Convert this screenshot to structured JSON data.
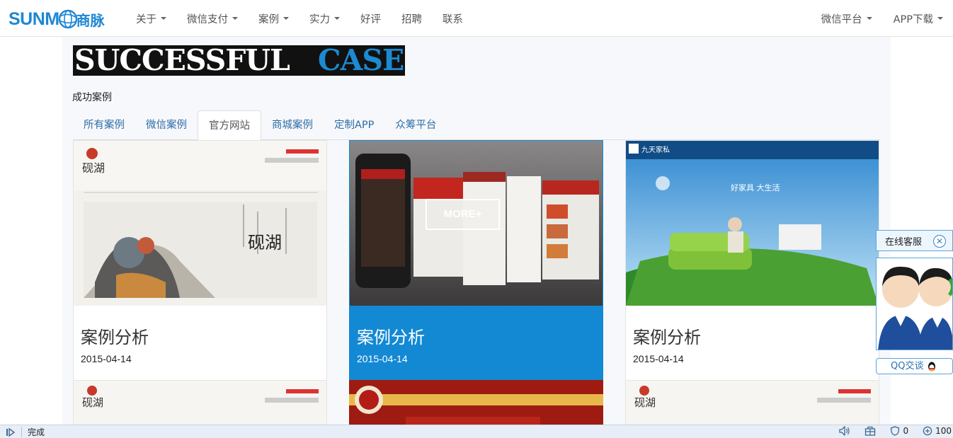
{
  "brand": {
    "name": "SUNM",
    "name_cn": "商脉"
  },
  "nav": {
    "items": [
      {
        "label": "关于",
        "dropdown": true
      },
      {
        "label": "微信支付",
        "dropdown": true
      },
      {
        "label": "案例",
        "dropdown": true
      },
      {
        "label": "实力",
        "dropdown": true
      },
      {
        "label": "好评",
        "dropdown": false
      },
      {
        "label": "招聘",
        "dropdown": false
      },
      {
        "label": "联系",
        "dropdown": false
      }
    ],
    "right": [
      {
        "label": "微信平台",
        "dropdown": true
      },
      {
        "label": "APP下载",
        "dropdown": true
      }
    ]
  },
  "banner": {
    "title_dark": "SUCCESSFUL",
    "title_blue": "CASE",
    "subtitle": "成功案例"
  },
  "tabs": [
    {
      "label": "所有案例",
      "active": false
    },
    {
      "label": "微信案例",
      "active": false
    },
    {
      "label": "官方网站",
      "active": true
    },
    {
      "label": "商城案例",
      "active": false
    },
    {
      "label": "定制APP",
      "active": false
    },
    {
      "label": "众筹平台",
      "active": false
    }
  ],
  "cards": [
    {
      "title": "案例分析",
      "date": "2015-04-14",
      "highlighted": false,
      "thumb_text": "砚湖"
    },
    {
      "title": "案例分析",
      "date": "2015-04-14",
      "highlighted": true,
      "overlay_button": "MORE+"
    },
    {
      "title": "案例分析",
      "date": "2015-04-14",
      "highlighted": false,
      "thumb_text": "九天家私",
      "thumb_slogan": "好家具 大生活"
    }
  ],
  "service_widget": {
    "title": "在线客服",
    "qq_label": "QQ交谈"
  },
  "statusbar": {
    "status": "完成",
    "counter": "0",
    "zoom": "100"
  },
  "colors": {
    "brand_blue": "#1e88d3",
    "highlight_blue": "#1389d4",
    "tab_link": "#2d6da3"
  }
}
